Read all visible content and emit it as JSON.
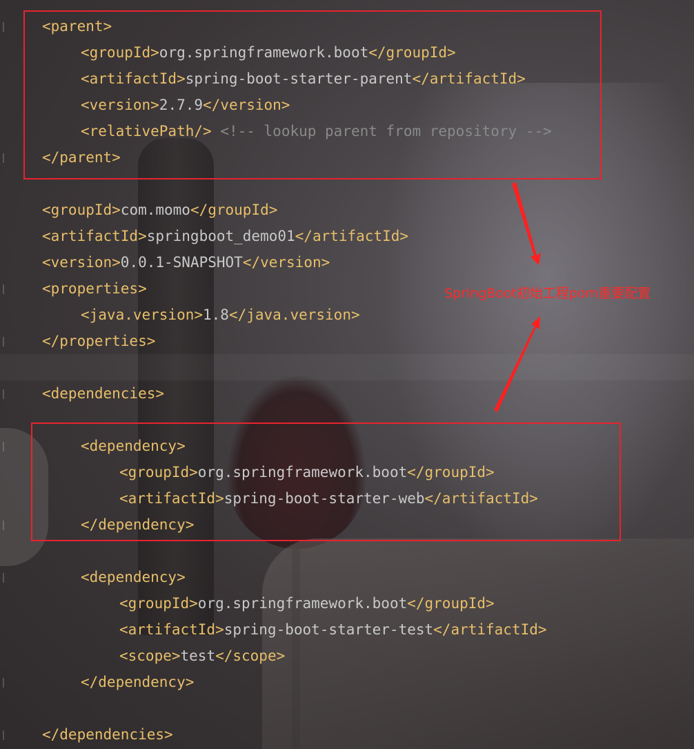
{
  "parent": {
    "open": "<parent>",
    "group_open": "<groupId>",
    "group_value": "org.springframework.boot",
    "group_close": "</groupId>",
    "artifact_open": "<artifactId>",
    "artifact_value": "spring-boot-starter-parent",
    "artifact_close": "</artifactId>",
    "version_open": "<version>",
    "version_value": "2.7.9",
    "version_close": "</version>",
    "relative_path": "<relativePath/>",
    "relative_comment": "<!-- lookup parent from repository -->",
    "close": "</parent>"
  },
  "project": {
    "group_open": "<groupId>",
    "group_value": "com.momo",
    "group_close": "</groupId>",
    "artifact_open": "<artifactId>",
    "artifact_value": "springboot_demo01",
    "artifact_close": "</artifactId>",
    "version_open": "<version>",
    "version_value": "0.0.1-SNAPSHOT",
    "version_close": "</version>"
  },
  "properties": {
    "open": "<properties>",
    "java_open": "<java.version>",
    "java_value": "1.8",
    "java_close": "</java.version>",
    "close": "</properties>"
  },
  "dependencies": {
    "open": "<dependencies>",
    "close": "</dependencies>",
    "items": [
      {
        "open": "<dependency>",
        "group_open": "<groupId>",
        "group_value": "org.springframework.boot",
        "group_close": "</groupId>",
        "artifact_open": "<artifactId>",
        "artifact_value": "spring-boot-starter-web",
        "artifact_close": "</artifactId>",
        "close": "</dependency>"
      },
      {
        "open": "<dependency>",
        "group_open": "<groupId>",
        "group_value": "org.springframework.boot",
        "group_close": "</groupId>",
        "artifact_open": "<artifactId>",
        "artifact_value": "spring-boot-starter-test",
        "artifact_close": "</artifactId>",
        "scope_open": "<scope>",
        "scope_value": "test",
        "scope_close": "</scope>",
        "close": "</dependency>"
      }
    ]
  },
  "annotation": {
    "text": "SpringBoot初始工程pom重要配置",
    "color": "#ff2a2a"
  },
  "colors": {
    "tag": "#e8bf6a",
    "text": "#c9c9c9",
    "comment": "#8a8a8a",
    "highlight_box": "#e8232e"
  }
}
